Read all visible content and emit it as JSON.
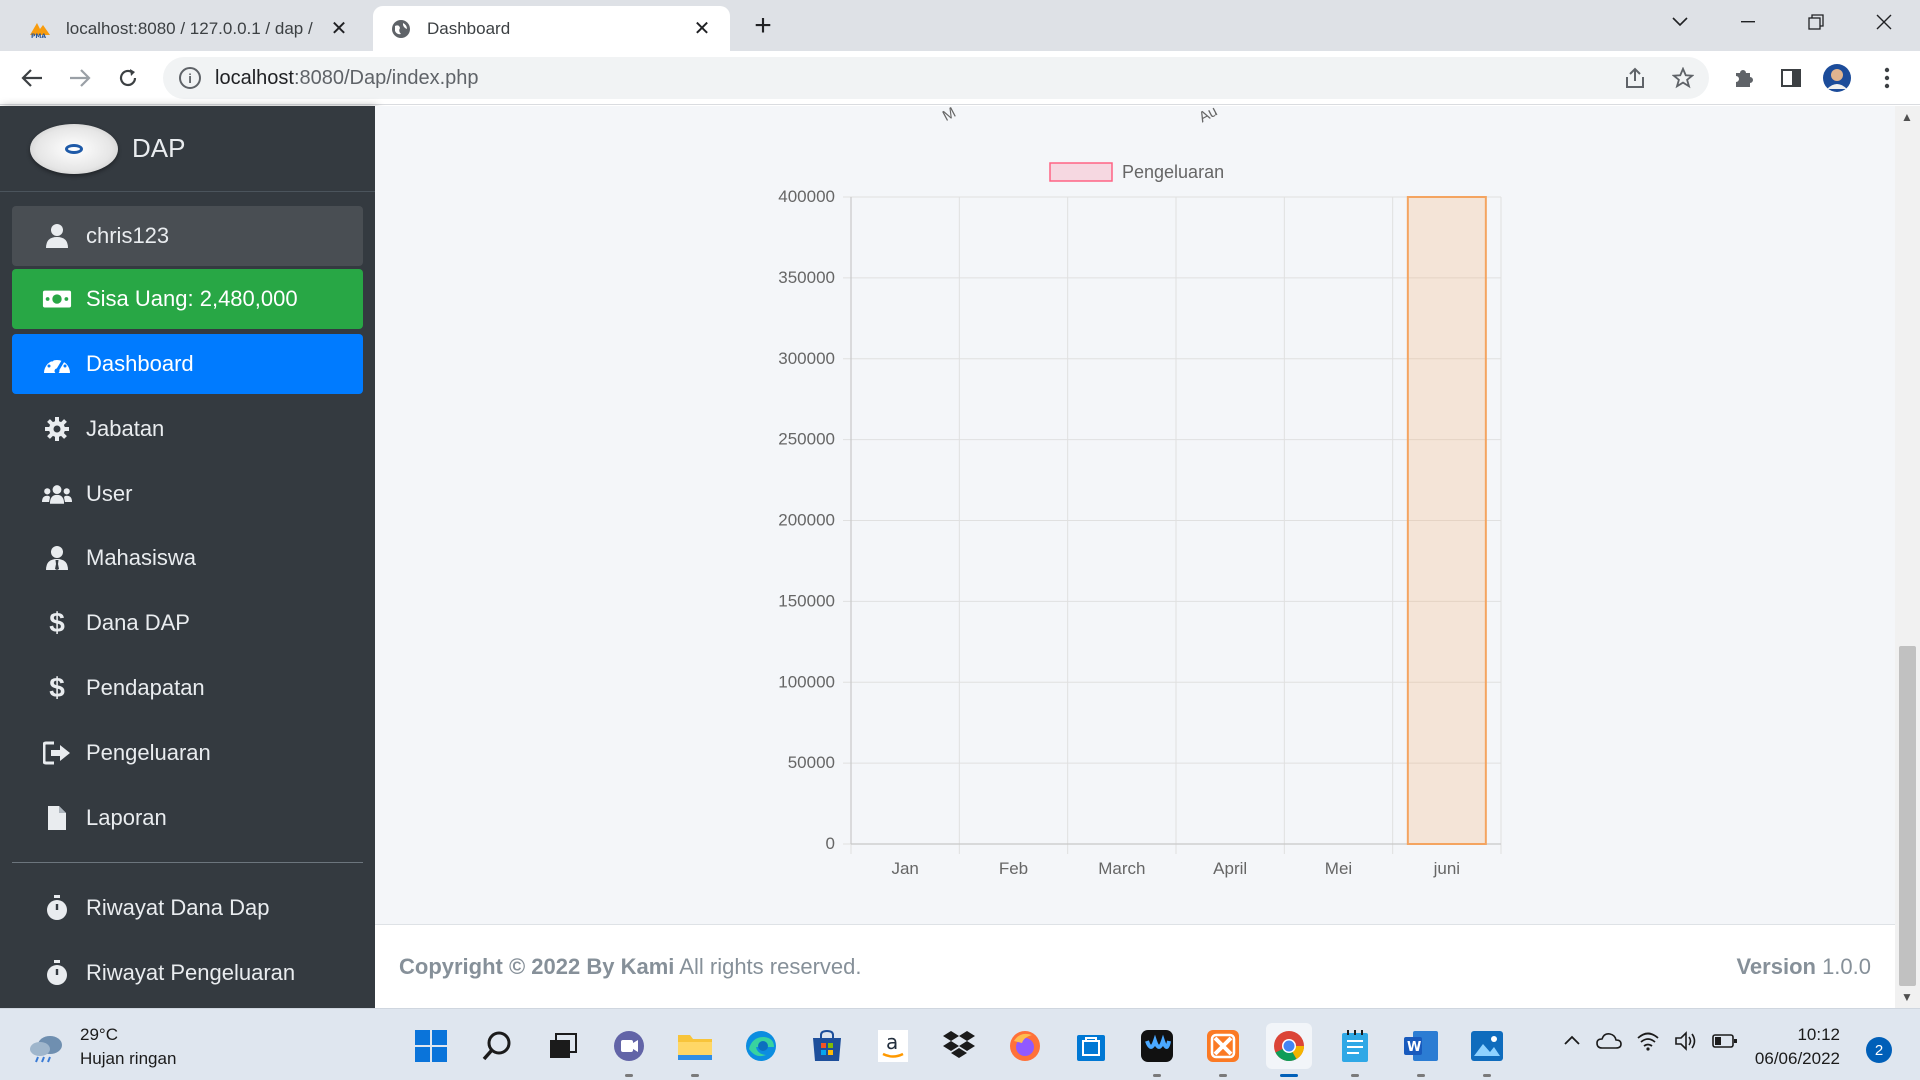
{
  "browser": {
    "tabs": [
      {
        "title": "localhost:8080 / 127.0.0.1 / dap /",
        "active": false,
        "icon": "phpmyadmin-icon"
      },
      {
        "title": "Dashboard",
        "active": true,
        "icon": "globe-icon"
      }
    ],
    "url_host": "localhost",
    "url_path": ":8080/Dap/index.php"
  },
  "sidebar": {
    "brand": "DAP",
    "user": "chris123",
    "saldo": "Sisa Uang: 2,480,000",
    "items": [
      {
        "label": "Dashboard",
        "icon": "tachometer-icon",
        "active": true
      },
      {
        "label": "Jabatan",
        "icon": "gear-icon"
      },
      {
        "label": "User",
        "icon": "users-icon"
      },
      {
        "label": "Mahasiswa",
        "icon": "user-tie-icon"
      },
      {
        "label": "Dana DAP",
        "icon": "dollar-icon"
      },
      {
        "label": "Pendapatan",
        "icon": "dollar-icon"
      },
      {
        "label": "Pengeluaran",
        "icon": "sign-out-icon"
      },
      {
        "label": "Laporan",
        "icon": "file-icon"
      }
    ],
    "history": [
      {
        "label": "Riwayat Dana Dap",
        "icon": "stopwatch-icon"
      },
      {
        "label": "Riwayat Pengeluaran",
        "icon": "stopwatch-icon"
      }
    ]
  },
  "content": {
    "axis_fragments": [
      "M",
      "Au"
    ]
  },
  "chart_data": {
    "type": "bar",
    "categories": [
      "Jan",
      "Feb",
      "March",
      "April",
      "Mei",
      "juni"
    ],
    "series": [
      {
        "name": "Pengeluaran",
        "values": [
          0,
          0,
          0,
          0,
          0,
          400000
        ],
        "color": "#f4a460"
      }
    ],
    "ylim": [
      0,
      400000
    ],
    "yticks": [
      0,
      50000,
      100000,
      150000,
      200000,
      250000,
      300000,
      350000,
      400000
    ],
    "legend_position": "top",
    "legend_color": "#ff6384",
    "grid": true
  },
  "footer": {
    "copyright_bold": "Copyright © 2022 By Kami",
    "copyright_rest": " All rights reserved.",
    "version_label": "Version",
    "version_value": " 1.0.0"
  },
  "taskbar": {
    "temperature": "29°C",
    "weather": "Hujan ringan",
    "time": "10:12",
    "date": "06/06/2022",
    "notifications": "2"
  },
  "colors": {
    "sidebar_bg": "#343a40",
    "success": "#28a745",
    "primary": "#007bff",
    "content_bg": "#f4f6f9"
  }
}
